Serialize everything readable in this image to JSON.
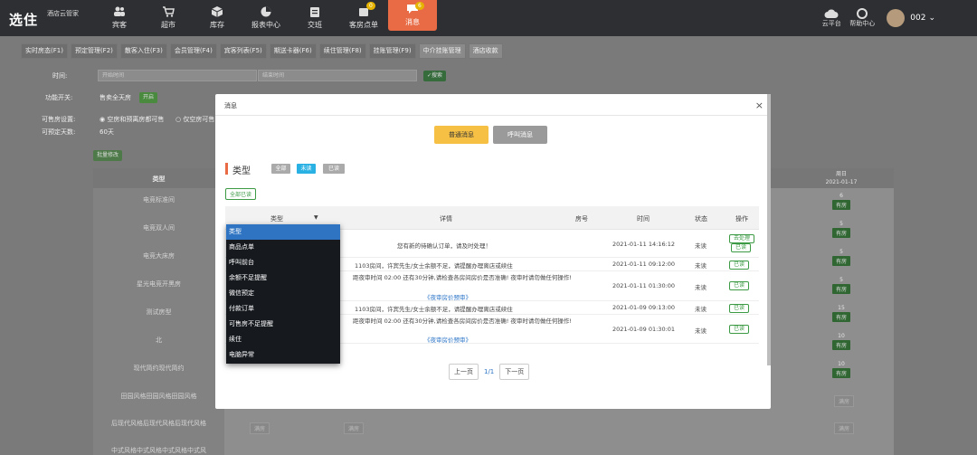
{
  "app": {
    "logo": "选住",
    "logo_sub": "酒店云管家",
    "nav": [
      {
        "label": "宾客",
        "icon": "people-icon"
      },
      {
        "label": "超市",
        "icon": "cart-icon"
      },
      {
        "label": "库存",
        "icon": "box-icon"
      },
      {
        "label": "报表中心",
        "icon": "pie-icon"
      },
      {
        "label": "交班",
        "icon": "clipboard-icon"
      },
      {
        "label": "客房点单",
        "icon": "order-icon",
        "badge": "0"
      },
      {
        "label": "消息",
        "icon": "message-icon",
        "badge": "6"
      }
    ],
    "right": [
      {
        "label": "云平台",
        "icon": "cloud-icon"
      },
      {
        "label": "帮助中心",
        "icon": "help-icon"
      }
    ],
    "user": "002"
  },
  "tabs": [
    "实时房态(F1)",
    "预定管理(F2)",
    "散客入住(F3)",
    "会员管理(F4)",
    "宾客列表(F5)",
    "期送卡器(F6)",
    "续住管理(F8)",
    "挂账管理(F9)",
    "中介挂账管理",
    "酒店收款"
  ],
  "filters": {
    "time_label": "时间:",
    "start_placeholder": "开始时间",
    "end_placeholder": "结束时间",
    "search_btn": "✓搜索",
    "switch_label": "功能开关:",
    "switch_text": "售卖全天房",
    "switch_state": "开启",
    "sellable_label": "可售房设置:",
    "opt1": "空房和预离房都可售",
    "opt2": "仅空房可售",
    "days_label": "可预定天数:",
    "days_value": "60天",
    "batch_btn": "批量修改"
  },
  "bg_table": {
    "type_header": "类型",
    "week_header": "周日",
    "date_header": "2021-01-17",
    "types": [
      "电竞标准间",
      "电竞双人间",
      "电竞大床房",
      "星光电竞开黑房",
      "测试房型",
      "北",
      "现代简约现代简约",
      "田园风格田园风格田园风格",
      "后现代风格后现代风格后现代风格",
      "中式风格中式风格中式风格中式风"
    ],
    "right_counts": [
      "6",
      "5",
      "5",
      "5",
      "15",
      "10",
      "10"
    ],
    "youfang": "有房",
    "manfang": "满房"
  },
  "modal": {
    "title": "消息",
    "close": "×",
    "btn_normal": "普通消息",
    "btn_call": "呼叫消息",
    "type_label": "类型",
    "chips": [
      "全部",
      "未读",
      "已读"
    ],
    "all_read": "全部已读",
    "columns": [
      "类型",
      "详情",
      "房号",
      "时间",
      "状态",
      "操作"
    ],
    "rows": [
      {
        "detail": "您有新的待确认订单，请及时处理！",
        "detail2": "",
        "time": "2021-01-11 14:16:12",
        "status": "未读",
        "actions": [
          "去处理",
          "已读"
        ]
      },
      {
        "detail": "1103房间，许宾先生/女士余额不足，请提醒办理离店或续住",
        "detail2": "",
        "time": "2021-01-11 09:12:00",
        "status": "未读",
        "actions": [
          "已读"
        ]
      },
      {
        "detail": "距夜审时间 02:00 还有30分钟,请检查各房间房价是否准确! 夜审时请勿做任何操作!",
        "detail2": "《夜审房价预审》",
        "time": "2021-01-11 01:30:00",
        "status": "未读",
        "actions": [
          "已读"
        ]
      },
      {
        "detail": "1103房间，许宾先生/女士余额不足，请提醒办理离店或续住",
        "detail2": "",
        "time": "2021-01-09 09:13:00",
        "status": "未读",
        "actions": [
          "已读"
        ]
      },
      {
        "detail": "距夜审时间 02:00 还有30分钟,请检查各房间房价是否准确! 夜审时请勿做任何操作!",
        "detail2": "《夜审房价预审》",
        "time": "2021-01-09 01:30:01",
        "status": "未读",
        "actions": [
          "已读"
        ]
      }
    ],
    "pager": {
      "prev": "上一页",
      "info": "1/1",
      "next": "下一页"
    },
    "dropdown": [
      "类型",
      "商品点单",
      "呼叫前台",
      "余额不足提醒",
      "微信预定",
      "付款订单",
      "可售房不足提醒",
      "续住",
      "电脑异常"
    ]
  }
}
